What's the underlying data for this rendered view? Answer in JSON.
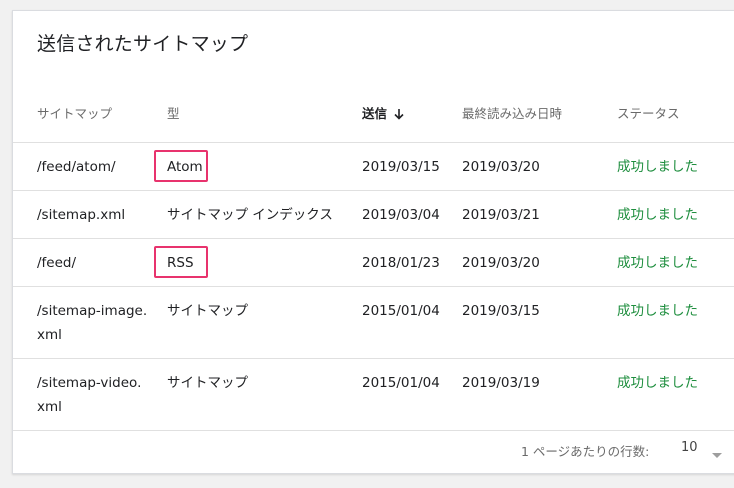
{
  "card": {
    "title": "送信されたサイトマップ"
  },
  "table": {
    "columns": {
      "sitemap": "サイトマップ",
      "type": "型",
      "submitted": "送信",
      "last_read": "最終読み込み日時",
      "status": "ステータス"
    },
    "sort_icon": "arrow-down-icon",
    "rows": [
      {
        "sitemap": "/feed/atom/",
        "type": "Atom",
        "submitted": "2019/03/15",
        "last_read": "2019/03/20",
        "status": "成功しました"
      },
      {
        "sitemap": "/sitemap.xml",
        "type": "サイトマップ インデックス",
        "submitted": "2019/03/04",
        "last_read": "2019/03/21",
        "status": "成功しました"
      },
      {
        "sitemap": "/feed/",
        "type": "RSS",
        "submitted": "2018/01/23",
        "last_read": "2019/03/20",
        "status": "成功しました"
      },
      {
        "sitemap": "/sitemap-image.xml",
        "type": "サイトマップ",
        "submitted": "2015/01/04",
        "last_read": "2019/03/15",
        "status": "成功しました"
      },
      {
        "sitemap": "/sitemap-video.xml",
        "type": "サイトマップ",
        "submitted": "2015/01/04",
        "last_read": "2019/03/19",
        "status": "成功しました"
      }
    ]
  },
  "pagination": {
    "rows_per_page_label": "1 ページあたりの行数:",
    "rows_per_page_value": "10",
    "dropdown_icon": "caret-down-icon"
  },
  "colors": {
    "status_success": "#1e8e3e",
    "highlight": "#e8336d"
  }
}
